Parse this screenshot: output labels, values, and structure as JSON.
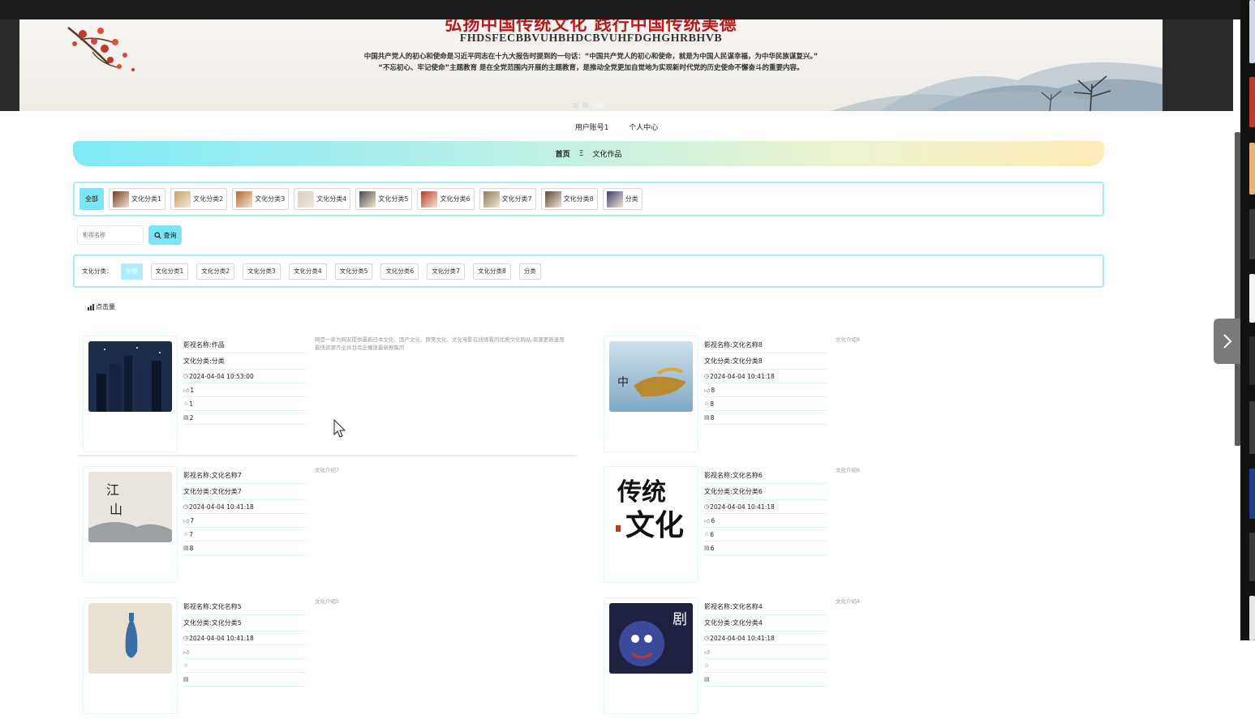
{
  "banner": {
    "heading": "弘扬中国传统文化 践行中国传统美德",
    "code_line": "FHDSFECBBVUHBHDCBVUHFDGHGHRBHVB",
    "quote_line1": "中国共产党人的初心和使命是习近平同志在十九大报告时提到的一句话：“中国共产党人的初心和使命，就是为中国人民谋幸福，为中华民族谋复兴。”",
    "quote_line2": "“不忘初心、牢记使命”主题教育 是在全党范围内开展的主题教育，是推动全党更加自觉地为实现新时代党的历史使命不懈奋斗的重要内容。"
  },
  "user_nav": {
    "account": "用户账号1",
    "center": "个人中心"
  },
  "breadcrumb": {
    "home": "首页",
    "separator": "Ξ",
    "current": "文化作品"
  },
  "categories": [
    {
      "label": "全部",
      "thumb": ""
    },
    {
      "label": "文化分类1",
      "thumb": "#7a3b22"
    },
    {
      "label": "文化分类2",
      "thumb": "#c9a36a"
    },
    {
      "label": "文化分类3",
      "thumb": "#b86a2b"
    },
    {
      "label": "文化分类4",
      "thumb": "#d6d0c4"
    },
    {
      "label": "文化分类5",
      "thumb": "#4a4a4a"
    },
    {
      "label": "文化分类6",
      "thumb": "#c0392b"
    },
    {
      "label": "文化分类7",
      "thumb": "#8c7a5b"
    },
    {
      "label": "文化分类8",
      "thumb": "#5e4a3a"
    },
    {
      "label": "分类",
      "thumb": "#3b3f6b"
    }
  ],
  "search": {
    "placeholder": "影视名称",
    "button": "查询"
  },
  "filter": {
    "label": "文化分类：",
    "options": [
      "全部",
      "文化分类1",
      "文化分类2",
      "文化分类3",
      "文化分类4",
      "文化分类5",
      "文化分类6",
      "文化分类7",
      "文化分类8",
      "分类"
    ]
  },
  "sort": {
    "label": "点击量"
  },
  "cards": [
    {
      "name": "影视名称:作品",
      "category": "文化分类:分类",
      "time": "2024-04-04 10:53:00",
      "likes": "1",
      "favorites": "1",
      "views": "2",
      "desc": "网是一家为网友提供最新日本文化、国产文化、欧美文化、文化电影在线观看的优质文化网站,资源更新速度最快资源齐全并且完全播放最新剧集的",
      "img": "#1c2b4a"
    },
    {
      "name": "影视名称:文化名称8",
      "category": "文化分类:文化分类8",
      "time": "2024-04-04 10:41:18",
      "likes": "8",
      "favorites": "8",
      "views": "8",
      "desc": "文化介绍8",
      "img": "#9fc3d8"
    },
    {
      "name": "影视名称:文化名称7",
      "category": "文化分类:文化分类7",
      "time": "2024-04-04 10:41:18",
      "likes": "7",
      "favorites": "7",
      "views": "8",
      "desc": "文化介绍7",
      "img": "#eae6df"
    },
    {
      "name": "影视名称:文化名称6",
      "category": "文化分类:文化分类6",
      "time": "2024-04-04 10:41:18",
      "likes": "6",
      "favorites": "6",
      "views": "6",
      "desc": "文化介绍6",
      "img": "#ffffff"
    },
    {
      "name": "影视名称:文化名称5",
      "category": "文化分类:文化分类5",
      "time": "2024-04-04 10:41:18",
      "likes": "",
      "favorites": "",
      "views": "",
      "desc": "文化介绍5",
      "img": "#e9e2d2"
    },
    {
      "name": "影视名称:文化名称4",
      "category": "文化分类:文化分类4",
      "time": "2024-04-04 10:41:18",
      "likes": "",
      "favorites": "",
      "views": "",
      "desc": "文化介绍4",
      "img": "#1e2240"
    }
  ],
  "card_art": {
    "card6_text": "传统文化"
  },
  "colors": {
    "accent": "#7ce5f4",
    "border": "#a8ecf4",
    "heading_red": "#b71c1c"
  },
  "icons": {
    "time": "clock-icon",
    "likes": "thumbs-up-icon",
    "favorites": "star-icon",
    "views": "views-icon",
    "search": "search-icon",
    "sort": "bar-chart-icon",
    "next": "chevron-right-icon"
  }
}
